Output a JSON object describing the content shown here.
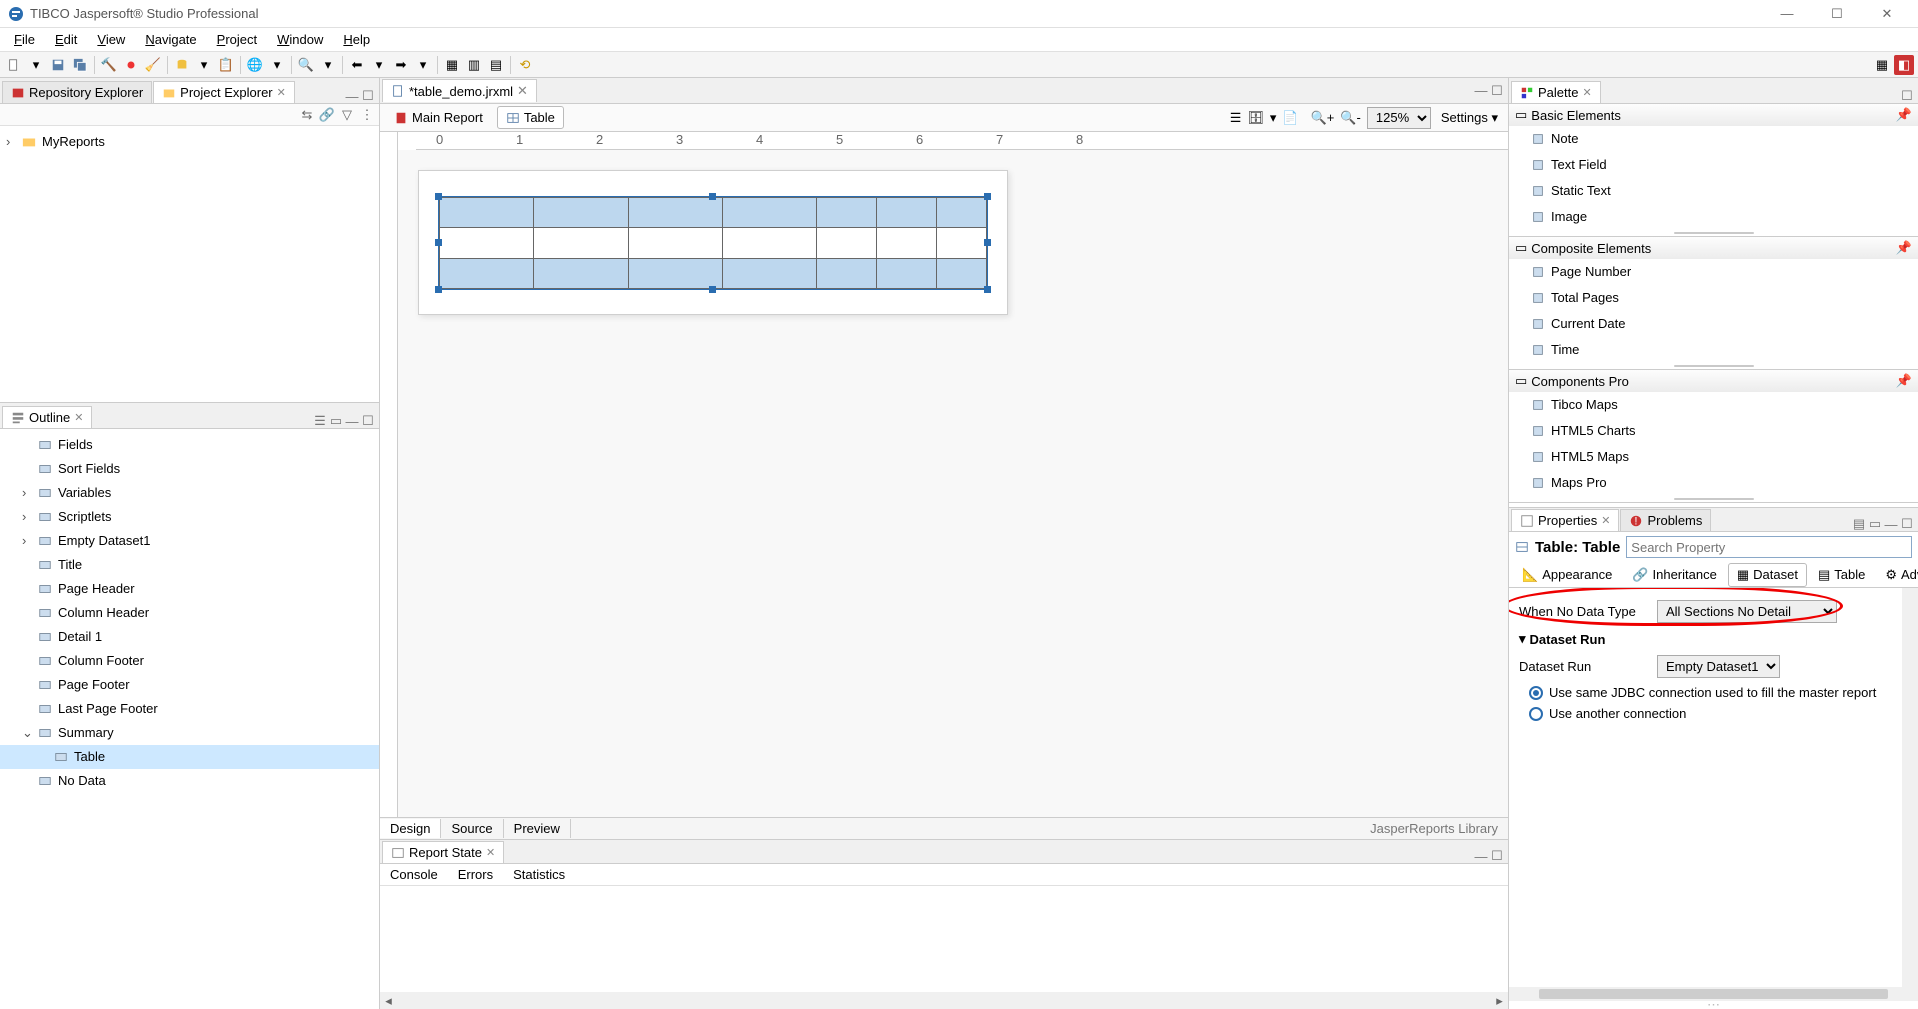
{
  "app": {
    "title": "TIBCO Jaspersoft® Studio Professional"
  },
  "menu": {
    "file": "File",
    "edit": "Edit",
    "view": "View",
    "navigate": "Navigate",
    "project": "Project",
    "window": "Window",
    "help": "Help"
  },
  "zoom": {
    "value": "125%"
  },
  "settings_label": "Settings",
  "left": {
    "explorer": {
      "tabs": [
        "Repository Explorer",
        "Project Explorer"
      ],
      "active": 1,
      "root": "MyReports"
    },
    "outline": {
      "title": "Outline",
      "items": [
        {
          "label": "Fields",
          "indent": 1
        },
        {
          "label": "Sort Fields",
          "indent": 1
        },
        {
          "label": "Variables",
          "indent": 1,
          "expand": true
        },
        {
          "label": "Scriptlets",
          "indent": 1,
          "expand": true
        },
        {
          "label": "Empty Dataset1",
          "indent": 1,
          "expand": true
        },
        {
          "label": "Title",
          "indent": 1
        },
        {
          "label": "Page Header",
          "indent": 1
        },
        {
          "label": "Column Header",
          "indent": 1
        },
        {
          "label": "Detail 1",
          "indent": 1
        },
        {
          "label": "Column Footer",
          "indent": 1
        },
        {
          "label": "Page Footer",
          "indent": 1
        },
        {
          "label": "Last Page Footer",
          "indent": 1
        },
        {
          "label": "Summary",
          "indent": 1,
          "expanded": true
        },
        {
          "label": "Table",
          "indent": 2,
          "selected": true
        },
        {
          "label": "No Data",
          "indent": 1
        }
      ]
    }
  },
  "editor": {
    "tab": "*table_demo.jrxml",
    "subtabs": {
      "main": "Main Report",
      "table": "Table"
    },
    "bottom_tabs": {
      "design": "Design",
      "source": "Source",
      "preview": "Preview"
    },
    "library": "JasperReports Library"
  },
  "report_state": {
    "title": "Report State",
    "tabs": {
      "console": "Console",
      "errors": "Errors",
      "statistics": "Statistics"
    }
  },
  "palette": {
    "title": "Palette",
    "sections": [
      {
        "name": "Basic Elements",
        "items": [
          "Note",
          "Text Field",
          "Static Text",
          "Image"
        ]
      },
      {
        "name": "Composite Elements",
        "items": [
          "Page Number",
          "Total Pages",
          "Current Date",
          "Time"
        ]
      },
      {
        "name": "Components Pro",
        "items": [
          "Tibco Maps",
          "HTML5 Charts",
          "HTML5 Maps",
          "Maps Pro"
        ]
      }
    ]
  },
  "props": {
    "tabs": {
      "properties": "Properties",
      "problems": "Problems"
    },
    "title": "Table: Table",
    "search_placeholder": "Search Property",
    "subtabs": {
      "appearance": "Appearance",
      "inheritance": "Inheritance",
      "dataset": "Dataset",
      "table": "Table",
      "advanced": "Advanced"
    },
    "when_no_data": {
      "label": "When No Data Type",
      "value": "All Sections No Detail"
    },
    "dataset_run": {
      "group": "Dataset Run",
      "label": "Dataset Run",
      "value": "Empty Dataset1"
    },
    "radio1": "Use same JDBC connection used to fill the master report",
    "radio2": "Use another connection"
  }
}
